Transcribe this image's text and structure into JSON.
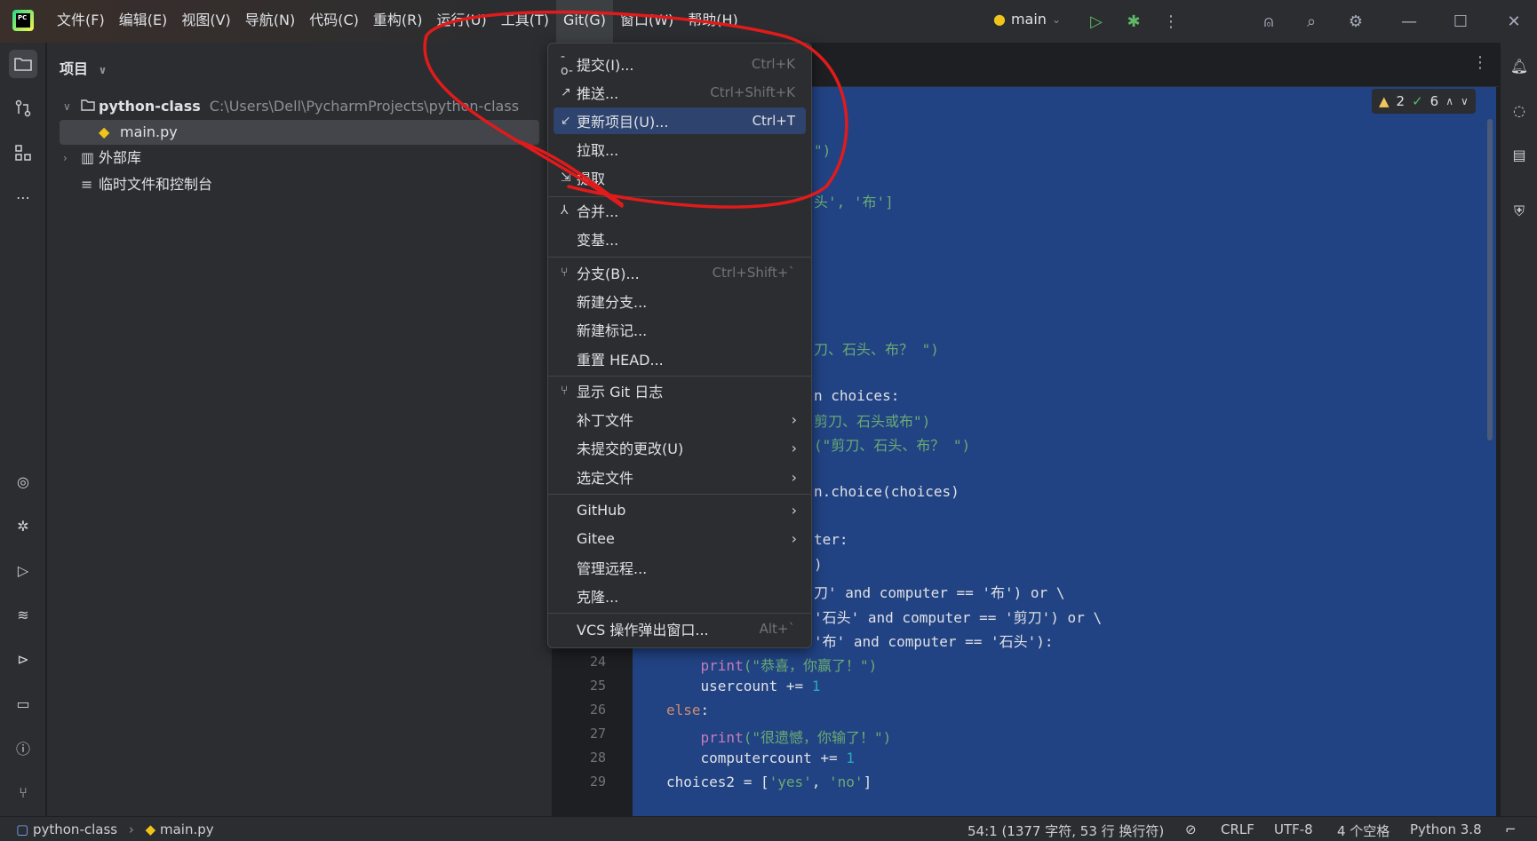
{
  "menubar": [
    "文件(F)",
    "编辑(E)",
    "视图(V)",
    "导航(N)",
    "代码(C)",
    "重构(R)",
    "运行(U)",
    "工具(T)",
    "Git(G)",
    "窗口(W)",
    "帮助(H)"
  ],
  "branch": "main",
  "project_panel": {
    "title": "项目",
    "tree": [
      {
        "label": "python-class",
        "path": "C:\\Users\\Dell\\PycharmProjects\\python-class"
      },
      {
        "label": "main.py"
      },
      {
        "label": "外部库"
      },
      {
        "label": "临时文件和控制台"
      }
    ]
  },
  "inspections": {
    "warnings": "2",
    "ok": "6"
  },
  "git_menu": [
    {
      "label": "提交(I)...",
      "shortcut": "Ctrl+K",
      "icon": "commit-icon"
    },
    {
      "label": "推送...",
      "shortcut": "Ctrl+Shift+K",
      "icon": "push-icon"
    },
    {
      "label": "更新项目(U)...",
      "shortcut": "Ctrl+T",
      "icon": "update-icon",
      "selected": true
    },
    {
      "label": "拉取...",
      "shortcut": "",
      "icon": ""
    },
    {
      "label": "提取",
      "shortcut": "",
      "icon": "fetch-icon"
    },
    {
      "label": "合并...",
      "shortcut": "",
      "icon": "merge-icon"
    },
    {
      "label": "变基...",
      "shortcut": "",
      "icon": ""
    },
    {
      "label": "分支(B)...",
      "shortcut": "Ctrl+Shift+`",
      "icon": "branch-icon"
    },
    {
      "label": "新建分支...",
      "shortcut": "",
      "icon": ""
    },
    {
      "label": "新建标记...",
      "shortcut": "",
      "icon": ""
    },
    {
      "label": "重置 HEAD...",
      "shortcut": "",
      "icon": ""
    },
    {
      "label": "显示 Git 日志",
      "shortcut": "",
      "icon": "git-log-icon"
    },
    {
      "label": "补丁文件",
      "shortcut": "",
      "icon": "",
      "submenu": true
    },
    {
      "label": "未提交的更改(U)",
      "shortcut": "",
      "icon": "",
      "submenu": true
    },
    {
      "label": "选定文件",
      "shortcut": "",
      "icon": "",
      "submenu": true
    },
    {
      "label": "GitHub",
      "shortcut": "",
      "icon": "",
      "submenu": true
    },
    {
      "label": "Gitee",
      "shortcut": "",
      "icon": "",
      "submenu": true
    },
    {
      "label": "管理远程...",
      "shortcut": "",
      "icon": ""
    },
    {
      "label": "克隆...",
      "shortcut": "",
      "icon": ""
    },
    {
      "label": "VCS 操作弹出窗口...",
      "shortcut": "Alt+`",
      "icon": ""
    }
  ],
  "code_visible": [
    {
      "line": "",
      "text": "\")"
    },
    {
      "line": "",
      "text": "头', '布']"
    },
    {
      "line": "",
      "text": "刀、石头、布？ \")"
    },
    {
      "line": "",
      "text": "n choices:"
    },
    {
      "line": "",
      "text": "剪刀、石头或布\")"
    },
    {
      "line": "",
      "text": "(\"剪刀、石头、布？ \")"
    },
    {
      "line": "",
      "text": "n.choice(choices)"
    },
    {
      "line": "",
      "text": "ter:"
    },
    {
      "line": "",
      "text": ")"
    },
    {
      "line": "",
      "text": "刀' and computer == '布') or \\"
    },
    {
      "line": "",
      "text": "'石头' and computer == '剪刀') or \\"
    },
    {
      "line": "",
      "text": "'布' and computer == '石头'):"
    },
    {
      "line": "24",
      "text": "    print(\"恭喜，你赢了！\")"
    },
    {
      "line": "25",
      "text": "    usercount += 1"
    },
    {
      "line": "26",
      "text": "else:"
    },
    {
      "line": "27",
      "text": "    print(\"很遗憾，你输了！\")"
    },
    {
      "line": "28",
      "text": "    computercount += 1"
    },
    {
      "line": "29",
      "text": "choices2 = ['yes', 'no']"
    }
  ],
  "statusbar": {
    "breadcrumb_project": "python-class",
    "breadcrumb_file": "main.py",
    "position": "54:1 (1377 字符, 53 行 换行符)",
    "line_ending": "CRLF",
    "encoding": "UTF-8",
    "indent": "4 个空格",
    "interpreter": "Python 3.8"
  }
}
